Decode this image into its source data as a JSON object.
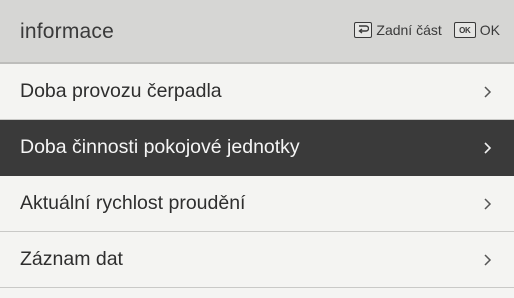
{
  "header": {
    "title": "informace",
    "back_icon": "back-arrow-icon",
    "back_label": "Zadní část",
    "ok_icon": "ok-key-icon",
    "ok_icon_text": "OK",
    "ok_label": "OK"
  },
  "menu": {
    "items": [
      {
        "label": "Doba provozu čerpadla",
        "selected": false,
        "icon": "chevron-right-icon"
      },
      {
        "label": "Doba činnosti pokojové jednotky",
        "selected": true,
        "icon": "chevron-right-icon"
      },
      {
        "label": "Aktuální rychlost proudění",
        "selected": false,
        "icon": "chevron-right-icon"
      },
      {
        "label": "Záznam dat",
        "selected": false,
        "icon": "chevron-right-icon"
      }
    ]
  },
  "colors": {
    "header_bg": "#d6d6d4",
    "list_bg": "#f4f4f2",
    "selected_bg": "#3a3a3a",
    "selected_text": "#f5f5f5",
    "text": "#2e2e2e"
  }
}
